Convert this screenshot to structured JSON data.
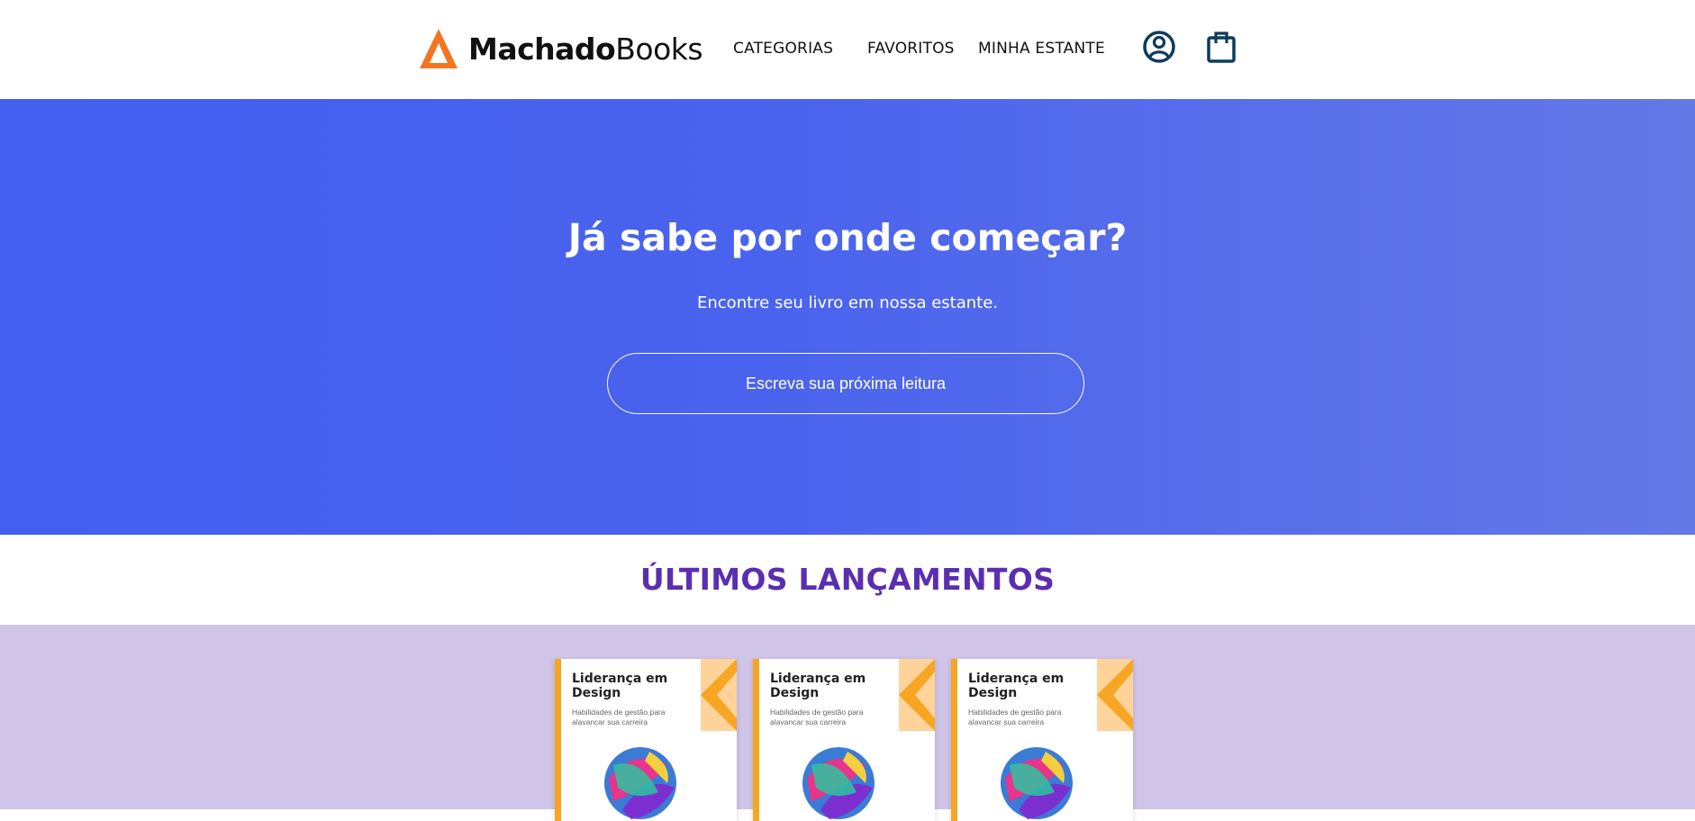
{
  "brand": {
    "name_bold": "Machado",
    "name_light": "Books",
    "logo_color": "#f47521"
  },
  "nav": {
    "categories": "CATEGORIAS",
    "favorites": "FAVORITOS",
    "shelf": "MINHA ESTANTE"
  },
  "icons": {
    "user": "user-circle-icon",
    "bag": "shopping-bag-icon",
    "color": "#0d3b5c"
  },
  "hero": {
    "title": "Já sabe por onde começar?",
    "subtitle": "Encontre seu livro em nossa estante.",
    "search_placeholder": "Escreva sua próxima leitura",
    "gradient": [
      "#425ff0",
      "#6478e6"
    ]
  },
  "releases": {
    "title": "ÚLTIMOS LANÇAMENTOS",
    "title_color": "#5a2eb0",
    "background": "#d0c5e8",
    "books": [
      {
        "title": "Liderança em Design",
        "subtitle": "Habilidades de gestão para alavancar sua carreira"
      },
      {
        "title": "Liderança em Design",
        "subtitle": "Habilidades de gestão para alavancar sua carreira"
      },
      {
        "title": "Liderança em Design",
        "subtitle": "Habilidades de gestão para alavancar sua carreira"
      }
    ]
  }
}
